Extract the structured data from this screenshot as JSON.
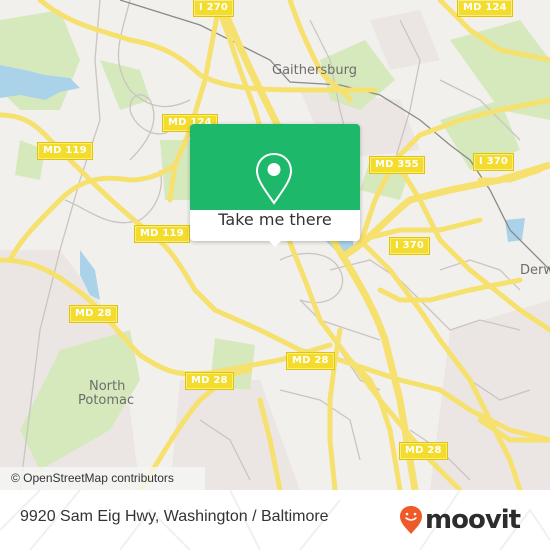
{
  "map": {
    "shields": [
      {
        "label": "I 270"
      },
      {
        "label": "MD 124"
      },
      {
        "label": "MD 124"
      },
      {
        "label": "MD 119"
      },
      {
        "label": "MD 355"
      },
      {
        "label": "I 370"
      },
      {
        "label": "MD 119"
      },
      {
        "label": "I 370"
      },
      {
        "label": "MD 28"
      },
      {
        "label": "MD 28"
      },
      {
        "label": "MD 28"
      },
      {
        "label": "MD 28"
      },
      {
        "label": "MD 28"
      }
    ],
    "places": [
      {
        "label": "Gaithersburg"
      },
      {
        "label": "Derw"
      },
      {
        "label": "North"
      },
      {
        "label": "Potomac"
      }
    ],
    "attribution": "© OpenStreetMap contributors",
    "colors": {
      "land": "#f2f0ec",
      "park": "#d4e8b8",
      "water": "#aad3ea",
      "road": "#f6e06e",
      "minor_road": "#c8c4c0"
    }
  },
  "popup": {
    "icon": "location-pin-icon",
    "button_label": "Take me there",
    "color": "#1db869"
  },
  "footer": {
    "address": "9920 Sam Eig Hwy, Washington / Baltimore",
    "brand": "moovit",
    "brand_icon": "moovit-pin-smile-icon",
    "brand_color": "#f05a28"
  }
}
